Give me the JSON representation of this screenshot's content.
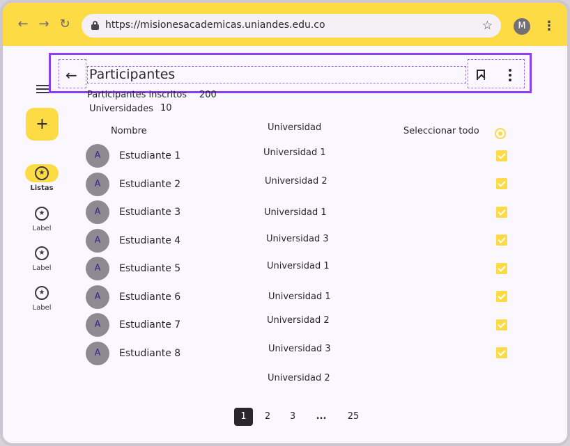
{
  "browser": {
    "url": "https://misionesacademicas.uniandes.edu.co",
    "profile_initial": "M",
    "back_icon": "arrow-left-icon",
    "forward_icon": "arrow-right-icon",
    "reload_icon": "reload-icon"
  },
  "rail": {
    "fab_icon": "plus-icon",
    "items": [
      {
        "label": "Listas",
        "icon": "star-circle-icon",
        "active": true
      },
      {
        "label": "Label",
        "icon": "star-circle-icon",
        "active": false
      },
      {
        "label": "Label",
        "icon": "star-circle-icon",
        "active": false
      },
      {
        "label": "Label",
        "icon": "star-circle-icon",
        "active": false
      }
    ]
  },
  "header": {
    "title": "Participantes",
    "back_icon": "arrow-left-icon",
    "bookmark_icon": "bookmark-icon",
    "more_icon": "more-vertical-icon"
  },
  "stats": {
    "inscritos_label": "Participantes inscritos",
    "inscritos_value": "200",
    "universidades_label": "Universidades",
    "universidades_value": "10"
  },
  "table": {
    "col_nombre": "Nombre",
    "col_universidad": "Universidad",
    "select_all": "Seleccionar todo",
    "rows": [
      {
        "initial": "A",
        "name": "Estudiante 1",
        "university": "Universidad 1",
        "checked": true
      },
      {
        "initial": "A",
        "name": "Estudiante 2",
        "university": "Universidad 2",
        "checked": true
      },
      {
        "initial": "A",
        "name": "Estudiante 3",
        "university": "Universidad 1",
        "checked": true
      },
      {
        "initial": "A",
        "name": "Estudiante 4",
        "university": "Universidad 3",
        "checked": true
      },
      {
        "initial": "A",
        "name": "Estudiante 5",
        "university": "Universidad 1",
        "checked": true
      },
      {
        "initial": "A",
        "name": "Estudiante 6",
        "university": "Universidad 1",
        "checked": true
      },
      {
        "initial": "A",
        "name": "Estudiante 7",
        "university": "Universidad 2",
        "checked": true
      },
      {
        "initial": "A",
        "name": "Estudiante 8",
        "university": "Universidad 3",
        "checked": true
      }
    ],
    "extra_university": "Universidad 2"
  },
  "pagination": {
    "pages": [
      "1",
      "2",
      "3",
      "...",
      "25"
    ],
    "current": "1"
  },
  "colors": {
    "accent": "#fcdb44",
    "selection": "#8a3ff0",
    "avatar": "#8e8a91"
  }
}
